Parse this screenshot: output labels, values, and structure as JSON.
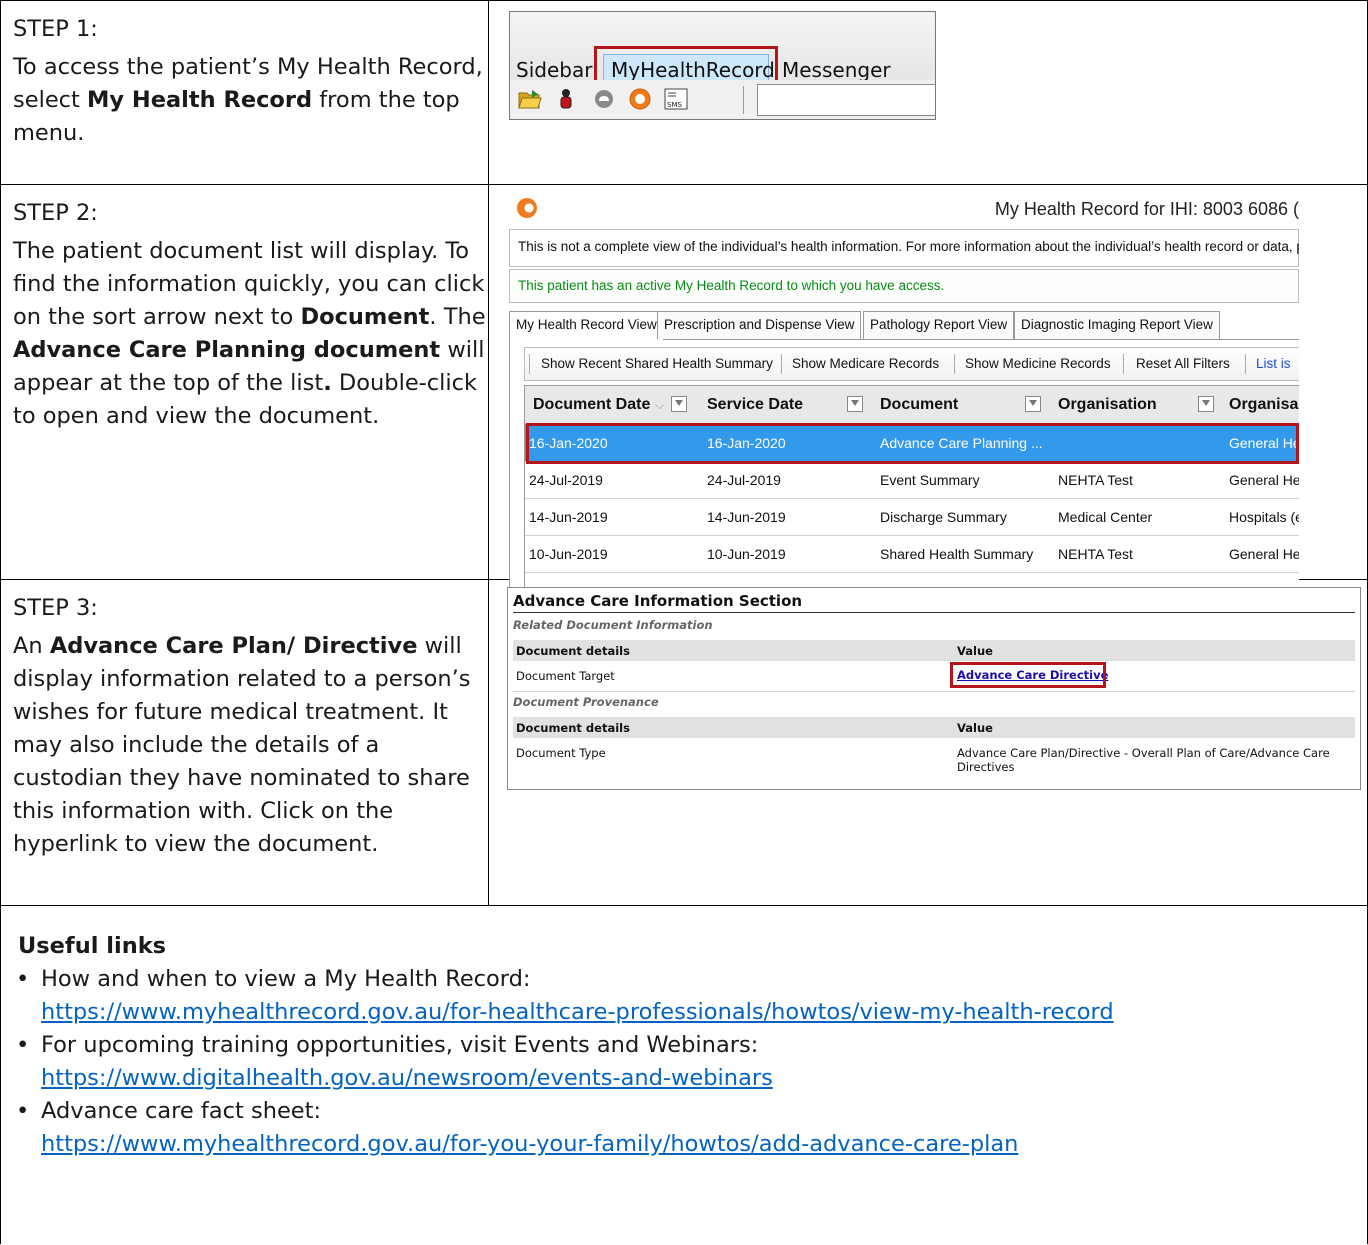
{
  "step1": {
    "label": "STEP 1:",
    "text_before": "To access the patient’s My Health Record, select ",
    "bold": "My Health Record",
    "text_after": " from the top menu.",
    "screenshot": {
      "menu_items": [
        "Sidebar",
        "MyHealthRecord",
        "Messenger"
      ],
      "toolbar_icons": [
        "folder-open-icon",
        "person-icon",
        "cloud-icon",
        "orange-badge-icon",
        "sms-icon"
      ],
      "sms_label": "SMS"
    }
  },
  "step2": {
    "label": "STEP 2:",
    "t1": "The patient document list will display. To find the information quickly, you can click on the sort arrow next to ",
    "b1": "Document",
    "t2": ". The ",
    "b2": "Advance Care Planning document",
    "t3": " will appear at the top of the list",
    "b3": ".",
    "t4": " Double-click to open and view the document.",
    "screenshot": {
      "window_title": "My Health Record for IHI: 8003 6086 (",
      "disclaimer": "This is not a complete view of the individual’s health information. For more information about the individual’s health record or data, pl",
      "active_notice": "This patient has an active My Health Record to which you have access.",
      "tabs": [
        "My Health Record View",
        "Prescription and Dispense View",
        "Pathology Report View",
        "Diagnostic Imaging Report View"
      ],
      "filters": [
        "Show Recent Shared Health Summary",
        "Show Medicare Records",
        "Show Medicine Records",
        "Reset All Filters",
        "List is"
      ],
      "columns": [
        "Document Date",
        "Service Date",
        "Document",
        "Organisation",
        "Organisa"
      ],
      "rows": [
        [
          "16-Jan-2020",
          "16-Jan-2020",
          "Advance Care Planning ...",
          "",
          "General He"
        ],
        [
          "24-Jul-2019",
          "24-Jul-2019",
          "Event Summary",
          "NEHTA Test",
          "General He"
        ],
        [
          "14-Jun-2019",
          "14-Jun-2019",
          "Discharge Summary",
          "Medical Center",
          "Hospitals (e"
        ],
        [
          "10-Jun-2019",
          "10-Jun-2019",
          "Shared Health Summary",
          "NEHTA Test",
          "General He"
        ]
      ],
      "selected_row_color": "#3399ea",
      "highlight_color": "#b3151b"
    }
  },
  "step3": {
    "label": "STEP 3:",
    "t1": "An ",
    "b1": "Advance Care Plan/ Directive",
    "t2": " will display information related to a person’s wishes for future medical treatment. It may also include the details of a custodian they have nominated to share this information with. Click on the hyperlink to view the document.",
    "screenshot": {
      "section_title": "Advance Care Information Section",
      "sub1": "Related Document Information",
      "header_col1": "Document details",
      "header_col2": "Value",
      "row1_label": "Document Target",
      "row1_link": "Advance Care Directive",
      "sub2": "Document Provenance",
      "row2_label": "Document Type",
      "row2_value_line1": "Advance Care Plan/Directive - Overall Plan of Care/Advance Care",
      "row2_value_line2": "Directives"
    }
  },
  "useful_links": {
    "heading": "Useful links",
    "items": [
      {
        "text": "How and when to view a My Health Record:",
        "url": "https://www.myhealthrecord.gov.au/for-healthcare-professionals/howtos/view-my-health-record"
      },
      {
        "text": "For upcoming training opportunities, visit Events and Webinars:",
        "url": "https://www.digitalhealth.gov.au/newsroom/events-and-webinars"
      },
      {
        "text": "Advance care fact sheet:",
        "url": "https://www.myhealthrecord.gov.au/for-you-your-family/howtos/add-advance-care-plan"
      }
    ],
    "link_color": "#0563c1"
  }
}
